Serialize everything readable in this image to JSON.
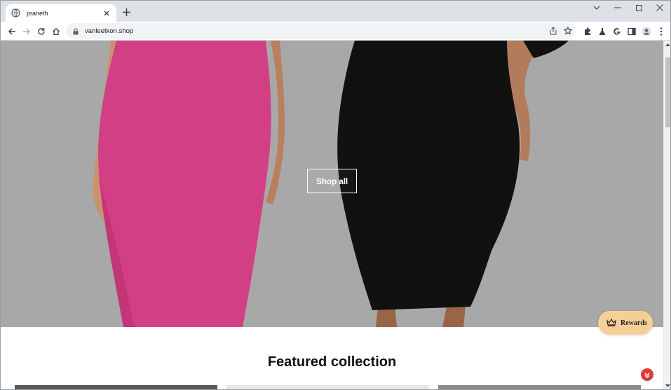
{
  "browser": {
    "tab_title": "praneth",
    "url": "vanleetkon.shop"
  },
  "hero": {
    "cta_label": "Shop all"
  },
  "featured": {
    "title": "Featured collection"
  },
  "rewards": {
    "label": "Rewards"
  },
  "colors": {
    "hero_bg": "#a9a8a8",
    "pink_dress": "#d23f85",
    "black_dress": "#111111",
    "rewards_bg": "#f6cf96",
    "chat_button": "#e03a3a"
  }
}
